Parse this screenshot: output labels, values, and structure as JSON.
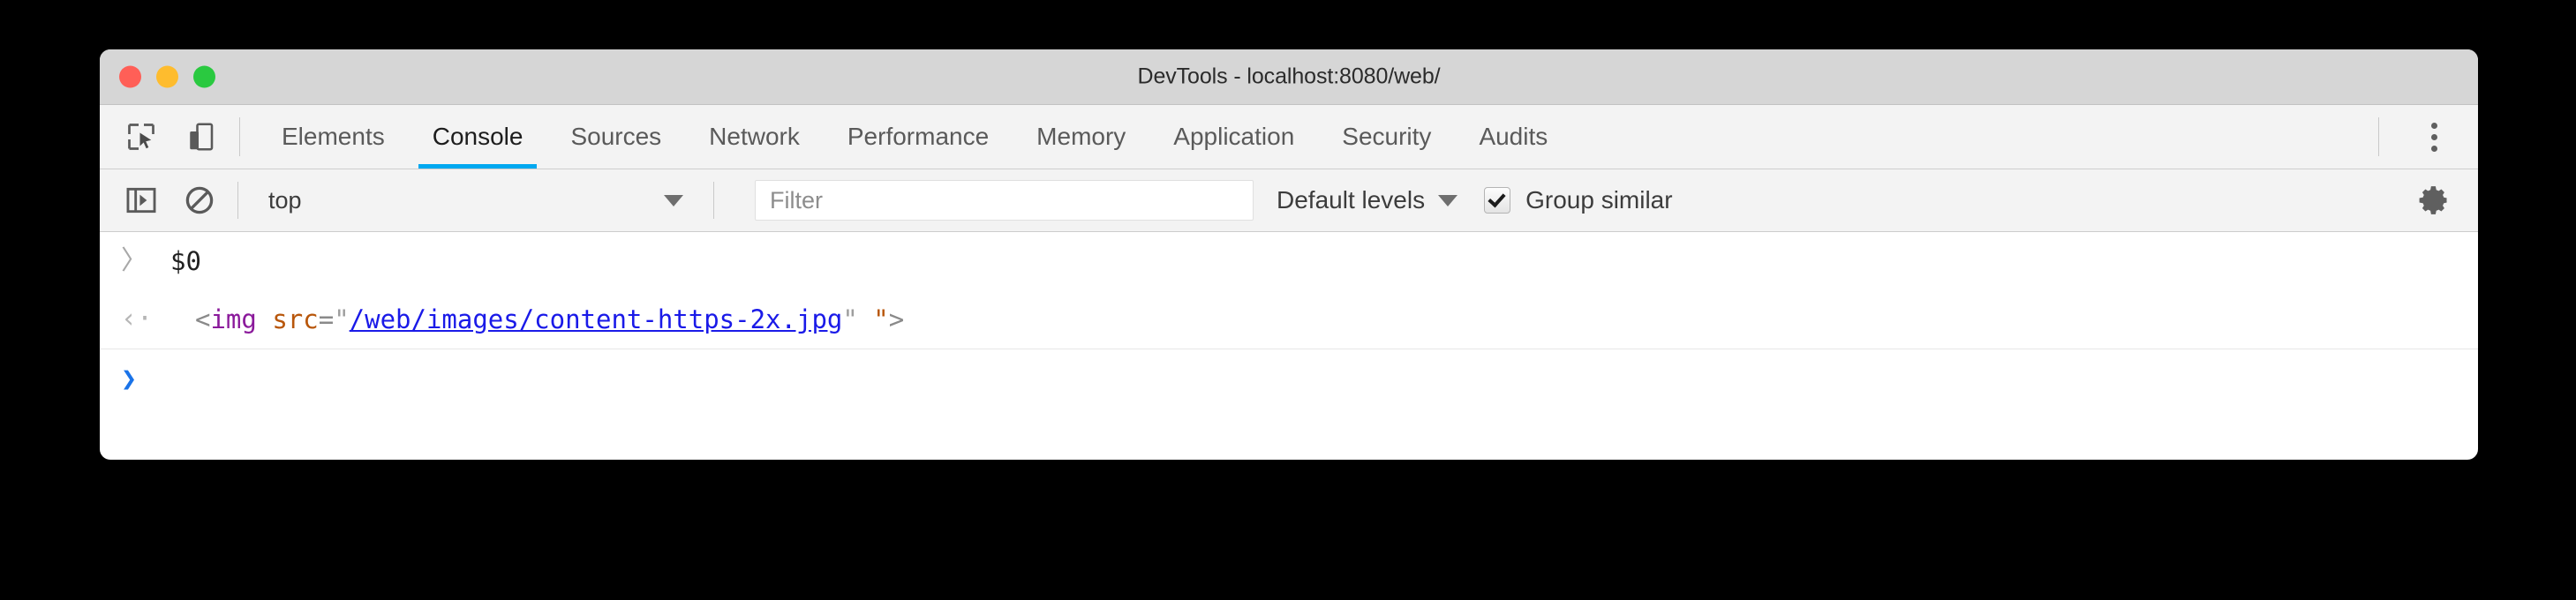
{
  "window": {
    "title": "DevTools - localhost:8080/web/",
    "traffic_lights": [
      {
        "name": "close",
        "color": "#ff5f57"
      },
      {
        "name": "minimize",
        "color": "#febc2e"
      },
      {
        "name": "maximize",
        "color": "#2ac940"
      }
    ]
  },
  "tabbar": {
    "icons": [
      {
        "name": "inspect-element-icon",
        "title": "Inspect element"
      },
      {
        "name": "device-toolbar-icon",
        "title": "Toggle device toolbar"
      }
    ],
    "tabs": [
      {
        "label": "Elements",
        "active": false
      },
      {
        "label": "Console",
        "active": true
      },
      {
        "label": "Sources",
        "active": false
      },
      {
        "label": "Network",
        "active": false
      },
      {
        "label": "Performance",
        "active": false
      },
      {
        "label": "Memory",
        "active": false
      },
      {
        "label": "Application",
        "active": false
      },
      {
        "label": "Security",
        "active": false
      },
      {
        "label": "Audits",
        "active": false
      }
    ],
    "active_tab": "Console",
    "active_underline_color": "#00a8f0",
    "more_menu": "more-options"
  },
  "console_toolbar": {
    "sidebar_toggle": "show-console-sidebar",
    "clear_console": "clear-console",
    "context": {
      "selected": "top",
      "caret": "▼"
    },
    "filter": {
      "value": "",
      "placeholder": "Filter"
    },
    "levels": {
      "label": "Default levels",
      "caret": "▼"
    },
    "group_similar": {
      "label": "Group similar",
      "checked": true
    },
    "settings": "console-settings"
  },
  "console": {
    "rows": [
      {
        "type": "input",
        "gutter": "〉",
        "text": "$0"
      },
      {
        "type": "result",
        "gutter": "‹·",
        "tokens": [
          {
            "cls": "tok-bracket",
            "text": "<"
          },
          {
            "cls": "tok-tag",
            "text": "img"
          },
          {
            "cls": "tok-bracket",
            "text": " "
          },
          {
            "cls": "tok-attr",
            "text": "src"
          },
          {
            "cls": "tok-eq",
            "text": "="
          },
          {
            "cls": "tok-quote",
            "text": "\""
          },
          {
            "cls": "tok-link",
            "text": "/web/images/content-https-2x.jpg"
          },
          {
            "cls": "tok-quote",
            "text": "\""
          },
          {
            "cls": "tok-bracket",
            "text": " "
          },
          {
            "cls": "tok-quote2",
            "text": "\""
          },
          {
            "cls": "tok-bracket",
            "text": ">"
          }
        ],
        "plain": "<img src=\"/web/images/content-https-2x.jpg\" \">"
      },
      {
        "type": "prompt",
        "gutter": "❯",
        "text": ""
      }
    ]
  }
}
